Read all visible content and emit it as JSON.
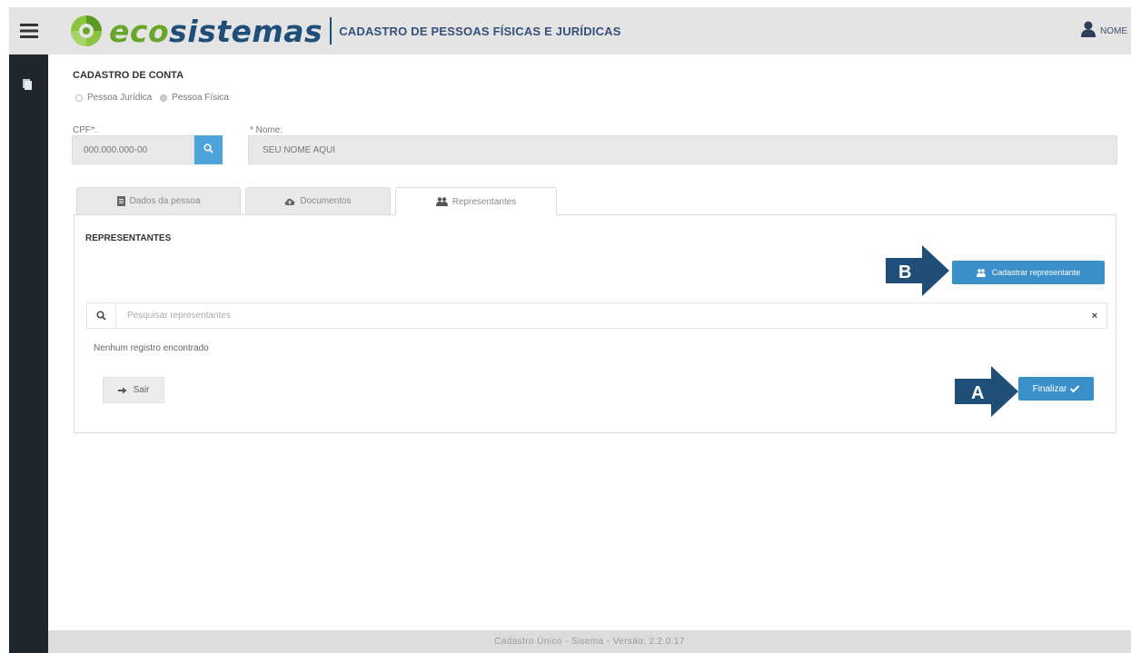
{
  "header": {
    "logo_eco": "eco",
    "logo_sistemas": "sistemas",
    "title": "CADASTRO DE PESSOAS FÍSICAS E JURÍDICAS",
    "user_name": "NOME"
  },
  "form": {
    "section_title": "CADASTRO DE CONTA",
    "radio_juridica": "Pessoa Jurídica",
    "radio_fisica": "Pessoa Física",
    "cpf_label": "CPF*:",
    "cpf_value": "000.000.000-00",
    "nome_label": "* Nome:",
    "nome_value": "SEU NOME AQUI"
  },
  "tabs": [
    {
      "label": "Dados da pessoa",
      "active": false
    },
    {
      "label": "Documentos",
      "active": false
    },
    {
      "label": "Representantes",
      "active": true
    }
  ],
  "panel": {
    "title": "REPRESENTANTES",
    "add_button": "Cadastrar representante",
    "search_placeholder": "Pesquisar representantes",
    "clear_symbol": "×",
    "empty_message": "Nenhum registro encontrado",
    "exit_button": "Sair",
    "finish_button": "Finalizar"
  },
  "annotations": {
    "a": "A",
    "b": "B"
  },
  "footer": {
    "text": "Cadastro Único - Sisema - Versão: 2.2.0.17"
  },
  "colors": {
    "primary_button": "#3a8fc9",
    "annotation_arrow": "#1f4e79",
    "brand_green": "#6aa52b",
    "brand_blue": "#1f4e79",
    "sidebar": "#21262c"
  },
  "icons": {
    "menu": "hamburger-icon",
    "user": "user-icon",
    "sidebar": "document-icon",
    "cpf_search": "search-icon",
    "tab1": "file-icon",
    "tab2": "cloud-upload-icon",
    "tab3": "users-icon",
    "add": "user-plus-icon",
    "exit": "sign-out-icon",
    "finish": "check-icon"
  }
}
